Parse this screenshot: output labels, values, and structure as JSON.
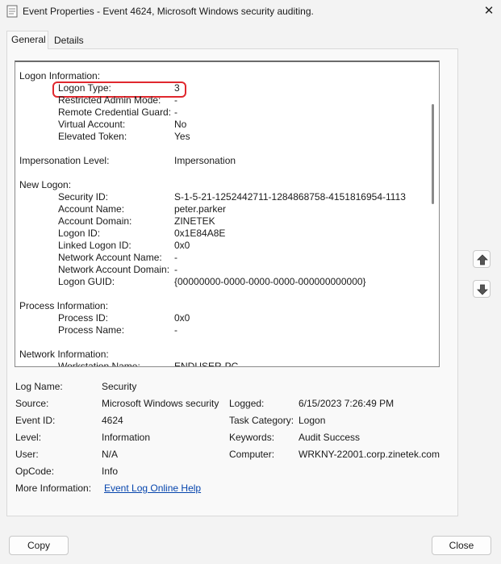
{
  "window": {
    "title": "Event Properties - Event 4624, Microsoft Windows security auditing.",
    "close_glyph": "✕"
  },
  "tabs": [
    {
      "label": "General",
      "active": true
    },
    {
      "label": "Details",
      "active": false
    }
  ],
  "description": {
    "highlight_color": "#e0282e",
    "lines": [
      {
        "label": "Logon Information:",
        "value": "",
        "indent": false
      },
      {
        "label": "Logon Type:",
        "value": "3",
        "indent": true,
        "highlighted": true
      },
      {
        "label": "Restricted Admin Mode:",
        "value": "-",
        "indent": true
      },
      {
        "label": "Remote Credential Guard:",
        "value": "-",
        "indent": true
      },
      {
        "label": "Virtual Account:",
        "value": "No",
        "indent": true
      },
      {
        "label": "Elevated Token:",
        "value": "Yes",
        "indent": true
      },
      {
        "label": "",
        "value": "",
        "indent": false
      },
      {
        "label": "Impersonation Level:",
        "value": "Impersonation",
        "indent": false
      },
      {
        "label": "",
        "value": "",
        "indent": false
      },
      {
        "label": "New Logon:",
        "value": "",
        "indent": false
      },
      {
        "label": "Security ID:",
        "value": "S-1-5-21-1252442711-1284868758-4151816954-1113",
        "indent": true
      },
      {
        "label": "Account Name:",
        "value": "peter.parker",
        "indent": true
      },
      {
        "label": "Account Domain:",
        "value": "ZINETEK",
        "indent": true
      },
      {
        "label": "Logon ID:",
        "value": "0x1E84A8E",
        "indent": true
      },
      {
        "label": "Linked Logon ID:",
        "value": "0x0",
        "indent": true
      },
      {
        "label": "Network Account Name:",
        "value": "-",
        "indent": true
      },
      {
        "label": "Network Account Domain:",
        "value": "-",
        "indent": true
      },
      {
        "label": "Logon GUID:",
        "value": "{00000000-0000-0000-0000-000000000000}",
        "indent": true
      },
      {
        "label": "",
        "value": "",
        "indent": false
      },
      {
        "label": "Process Information:",
        "value": "",
        "indent": false
      },
      {
        "label": "Process ID:",
        "value": "0x0",
        "indent": true
      },
      {
        "label": "Process Name:",
        "value": "-",
        "indent": true
      },
      {
        "label": "",
        "value": "",
        "indent": false
      },
      {
        "label": "Network Information:",
        "value": "",
        "indent": false
      },
      {
        "label": "Workstation Name:",
        "value": "ENDUSER-PC",
        "indent": true
      }
    ]
  },
  "meta": {
    "log_name_label": "Log Name:",
    "log_name_value": "Security",
    "source_label": "Source:",
    "source_value": "Microsoft Windows security",
    "logged_label": "Logged:",
    "logged_value": "6/15/2023 7:26:49 PM",
    "event_id_label": "Event ID:",
    "event_id_value": "4624",
    "task_category_label": "Task Category:",
    "task_category_value": "Logon",
    "level_label": "Level:",
    "level_value": "Information",
    "keywords_label": "Keywords:",
    "keywords_value": "Audit Success",
    "user_label": "User:",
    "user_value": "N/A",
    "computer_label": "Computer:",
    "computer_value": "WRKNY-22001.corp.zinetek.com",
    "opcode_label": "OpCode:",
    "opcode_value": "Info",
    "more_info_label": "More Information:",
    "more_info_link": "Event Log Online Help"
  },
  "buttons": {
    "copy": "Copy",
    "close": "Close"
  },
  "icons": {
    "scroll_up": "arrow-up-icon",
    "scroll_down": "arrow-down-icon"
  }
}
